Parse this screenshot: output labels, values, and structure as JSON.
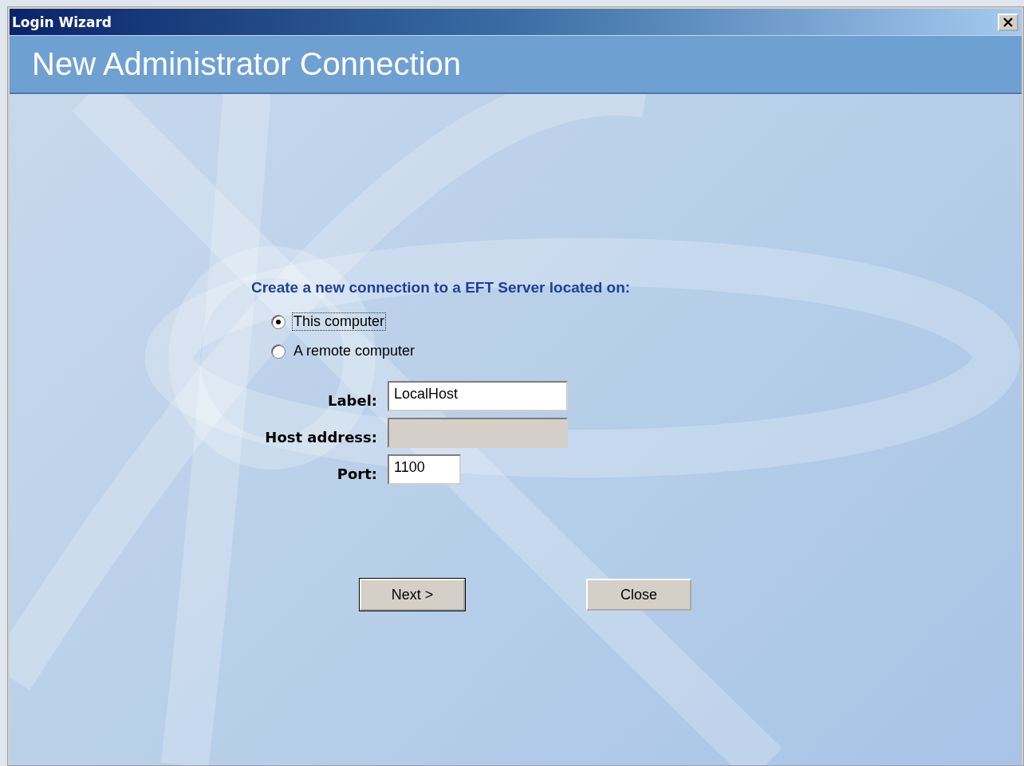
{
  "window": {
    "title": "Login Wizard"
  },
  "header": {
    "title": "New Administrator Connection"
  },
  "prompt": "Create a new connection to a EFT Server located on:",
  "options": [
    {
      "label": "This computer",
      "selected": true,
      "focused": true
    },
    {
      "label": "A remote computer",
      "selected": false,
      "focused": false
    }
  ],
  "fields": [
    {
      "kind": "text",
      "label": "Label:",
      "value": "LocalHost",
      "disabled": false
    },
    {
      "kind": "text",
      "label": "Host address:",
      "disabled": true
    },
    {
      "kind": "number",
      "label": "Port:",
      "value": "1100",
      "disabled": false
    }
  ],
  "buttons": [
    {
      "label": "Next >",
      "default": true
    },
    {
      "label": "Close",
      "default": false
    }
  ]
}
